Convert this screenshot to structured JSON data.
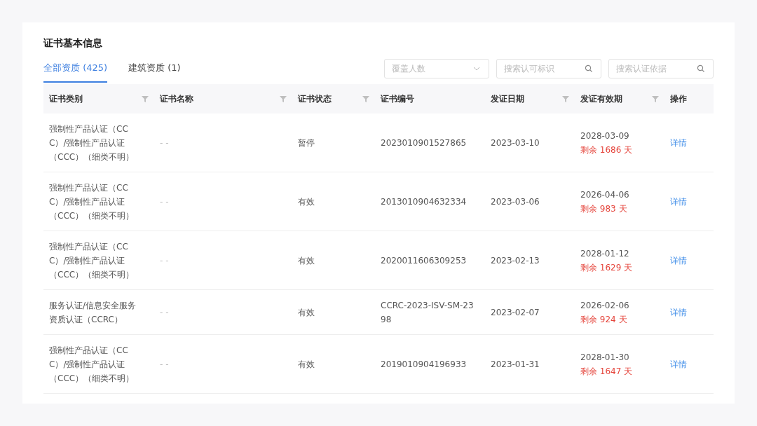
{
  "card": {
    "title": "证书基本信息"
  },
  "tabs": [
    {
      "label": "全部资质 (425)",
      "selected": true
    },
    {
      "label": "建筑资质 (1)",
      "selected": false
    }
  ],
  "filters": [
    {
      "kind": "select",
      "placeholder": "覆盖人数"
    },
    {
      "kind": "search",
      "placeholder": "搜索认可标识"
    },
    {
      "kind": "search",
      "placeholder": "搜索认证依据"
    }
  ],
  "table": {
    "columns": [
      {
        "label": "证书类别",
        "filterable": true
      },
      {
        "label": "证书名称",
        "filterable": true
      },
      {
        "label": "证书状态",
        "filterable": true
      },
      {
        "label": "证书编号",
        "filterable": false
      },
      {
        "label": "发证日期",
        "filterable": true
      },
      {
        "label": "发证有效期",
        "filterable": true
      },
      {
        "label": "操作",
        "filterable": false
      }
    ],
    "rows": [
      {
        "category": "强制性产品认证（CCC）/强制性产品认证（CCC）（细类不明）",
        "name": "- -",
        "status": "暂停",
        "number": "2023010901527865",
        "issue_date": "2023-03-10",
        "expiry_date": "2028-03-09",
        "remaining": "剩余 1686 天",
        "action": "详情"
      },
      {
        "category": "强制性产品认证（CCC）/强制性产品认证（CCC）（细类不明）",
        "name": "- -",
        "status": "有效",
        "number": "2013010904632334",
        "issue_date": "2023-03-06",
        "expiry_date": "2026-04-06",
        "remaining": "剩余 983 天",
        "action": "详情"
      },
      {
        "category": "强制性产品认证（CCC）/强制性产品认证（CCC）（细类不明）",
        "name": "- -",
        "status": "有效",
        "number": "2020011606309253",
        "issue_date": "2023-02-13",
        "expiry_date": "2028-01-12",
        "remaining": "剩余 1629 天",
        "action": "详情"
      },
      {
        "category": "服务认证/信息安全服务资质认证（CCRC）",
        "name": "- -",
        "status": "有效",
        "number": "CCRC-2023-ISV-SM-2398",
        "issue_date": "2023-02-07",
        "expiry_date": "2026-02-06",
        "remaining": "剩余 924 天",
        "action": "详情"
      },
      {
        "category": "强制性产品认证（CCC）/强制性产品认证（CCC）（细类不明）",
        "name": "- -",
        "status": "有效",
        "number": "2019010904196933",
        "issue_date": "2023-01-31",
        "expiry_date": "2028-01-30",
        "remaining": "剩余 1647 天",
        "action": "详情"
      }
    ]
  }
}
